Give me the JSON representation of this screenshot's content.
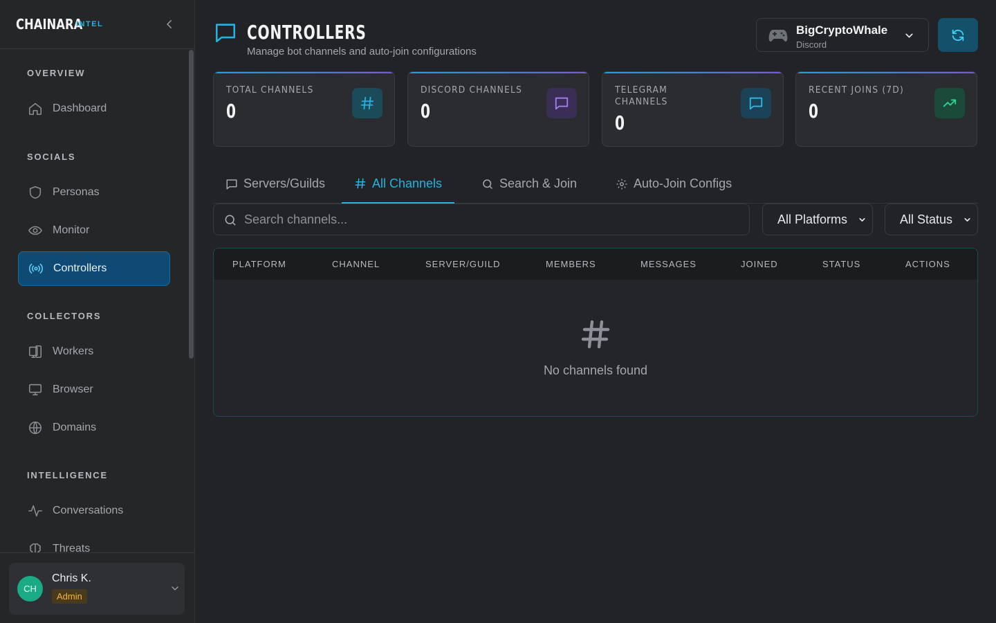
{
  "brand": {
    "name": "CHAINARA",
    "tag": "INTEL"
  },
  "sidebar": {
    "sections": [
      {
        "label": "OVERVIEW"
      },
      {
        "label": "SOCIALS"
      },
      {
        "label": "COLLECTORS"
      },
      {
        "label": "INTELLIGENCE"
      }
    ],
    "items": [
      {
        "label": "Dashboard",
        "icon": "home-icon"
      },
      {
        "label": "Personas",
        "icon": "shield-icon"
      },
      {
        "label": "Monitor",
        "icon": "eye-icon"
      },
      {
        "label": "Controllers",
        "icon": "broadcast-icon",
        "active": true
      },
      {
        "label": "Workers",
        "icon": "devices-icon"
      },
      {
        "label": "Browser",
        "icon": "monitor-icon"
      },
      {
        "label": "Domains",
        "icon": "globe-icon"
      },
      {
        "label": "Conversations",
        "icon": "activity-icon"
      },
      {
        "label": "Threats",
        "icon": "brain-icon"
      }
    ]
  },
  "user": {
    "initials": "CH",
    "name": "Chris K.",
    "role": "Admin"
  },
  "header": {
    "title": "CONTROLLERS",
    "subtitle": "Manage bot channels and auto-join configurations"
  },
  "bot": {
    "name": "BigCryptoWhale",
    "platform": "Discord"
  },
  "stats": [
    {
      "label": "TOTAL CHANNELS",
      "value": "0",
      "icon": "hash-icon",
      "color": "#22b4e0",
      "bg": "#1b4a58"
    },
    {
      "label": "DISCORD CHANNELS",
      "value": "0",
      "icon": "chat-icon",
      "color": "#a77df0",
      "bg": "#3a2e55"
    },
    {
      "label": "TELEGRAM CHANNELS",
      "value": "0",
      "icon": "chat-icon",
      "color": "#2fb8e6",
      "bg": "#1b4256"
    },
    {
      "label": "RECENT JOINS (7D)",
      "value": "0",
      "icon": "trending-up-icon",
      "color": "#2ed38f",
      "bg": "#1c4a3a"
    }
  ],
  "tabs": [
    {
      "label": "Servers/Guilds"
    },
    {
      "label": "All Channels",
      "active": true
    },
    {
      "label": "Search & Join"
    },
    {
      "label": "Auto-Join Configs"
    }
  ],
  "filters": {
    "search_placeholder": "Search channels...",
    "platform": "All Platforms",
    "status": "All Status"
  },
  "table": {
    "columns": [
      "PLATFORM",
      "CHANNEL",
      "SERVER/GUILD",
      "MEMBERS",
      "MESSAGES",
      "JOINED",
      "STATUS",
      "ACTIONS"
    ],
    "empty_text": "No channels found"
  }
}
